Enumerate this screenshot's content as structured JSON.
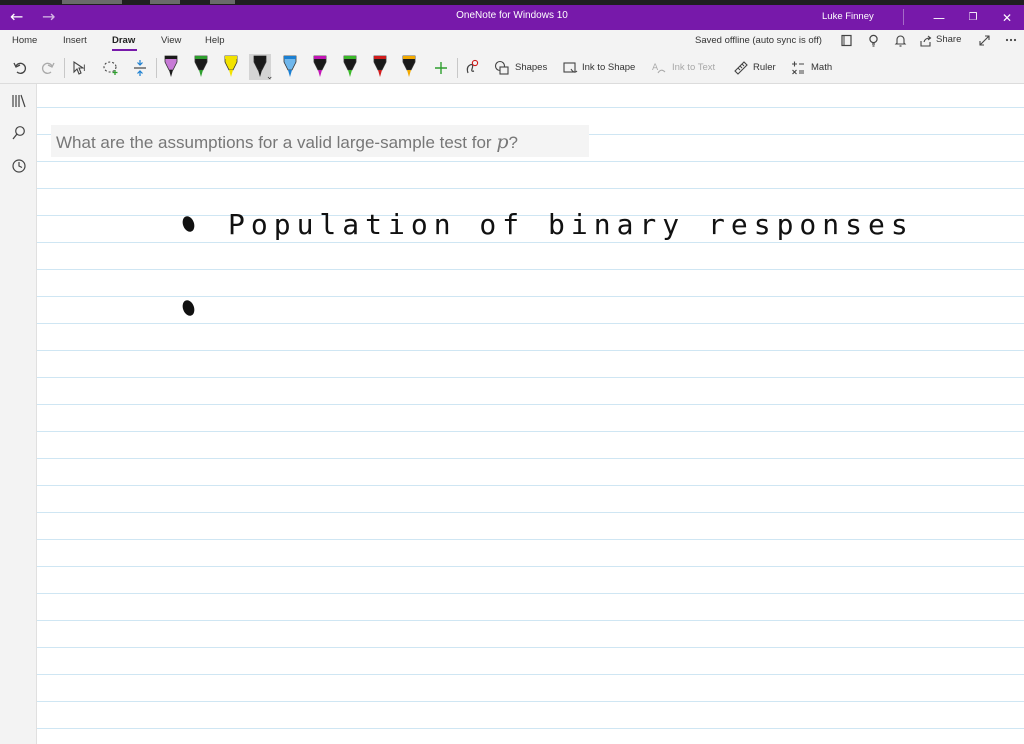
{
  "window": {
    "title": "OneNote for Windows 10",
    "user": "Luke Finney",
    "back_glyph": "←",
    "forward_glyph": "→",
    "minimize_glyph": "—",
    "restore_glyph": "❐",
    "close_glyph": "✕"
  },
  "ribbon": {
    "tabs": [
      "Home",
      "Insert",
      "Draw",
      "View",
      "Help"
    ],
    "active_tab": "Draw",
    "status": "Saved offline (auto sync is off)",
    "share_label": "Share"
  },
  "toolbar": {
    "shapes_label": "Shapes",
    "ink_to_shape_label": "Ink to Shape",
    "ink_to_text_label": "Ink to Text",
    "ruler_label": "Ruler",
    "math_label": "Math",
    "pens": [
      {
        "tip": "#1a1a1a",
        "body": "#c77ad6"
      },
      {
        "tip": "#2e9e2e",
        "body": "#1a1a1a"
      },
      {
        "tip": "#f2e200",
        "body": "#f2e200"
      },
      {
        "tip": "#1a1a1a",
        "body": "#1a1a1a"
      },
      {
        "tip": "#1b7fd1",
        "body": "#6fb7ec"
      },
      {
        "tip": "#c215b5",
        "body": "#1a1a1a"
      },
      {
        "tip": "#3bb829",
        "body": "#1a1a1a"
      },
      {
        "tip": "#d01c1c",
        "body": "#1a1a1a"
      },
      {
        "tip": "#f2a900",
        "body": "#1a1a1a"
      }
    ],
    "accent": "#7719aa"
  },
  "page": {
    "question_text": "What are the assumptions for a valid large-sample test for ",
    "question_var": "p",
    "question_end": "?",
    "ink_line_1": "Population of binary responses"
  }
}
